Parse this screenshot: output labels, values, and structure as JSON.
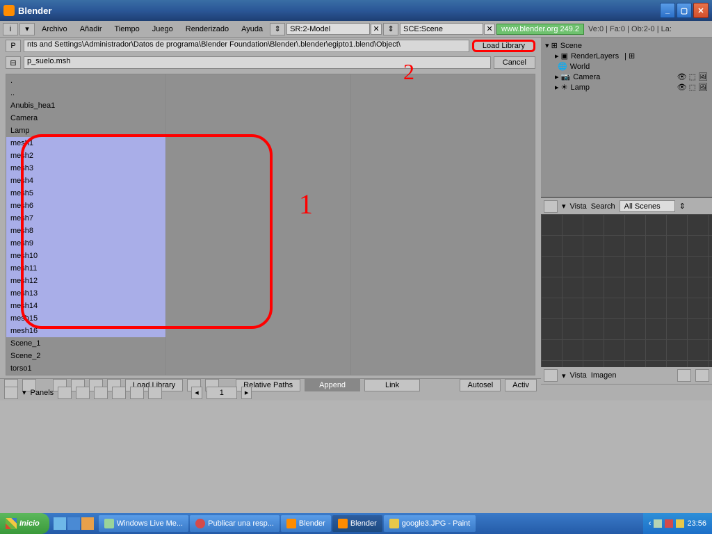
{
  "window": {
    "title": "Blender"
  },
  "menubar": {
    "items": [
      "Archivo",
      "Añadir",
      "Tiempo",
      "Juego",
      "Renderizado",
      "Ayuda"
    ],
    "screen_sel": "SR:2-Model",
    "scene_sel": "SCE:Scene",
    "url": "www.blender.org 249.2",
    "stats": "Ve:0 | Fa:0 | Ob:2-0 | La:"
  },
  "file": {
    "path": "nts and Settings\\Administrador\\Datos de programa\\Blender Foundation\\Blender\\.blender\\egipto1.blend\\Object\\",
    "filename": "p_suelo.msh",
    "load_btn": "Load Library",
    "cancel_btn": "Cancel",
    "items_top": [
      ".",
      "..",
      "Anubis_hea1",
      "Camera",
      "Lamp"
    ],
    "items_sel": [
      "mesh1",
      "mesh2",
      "mesh3",
      "mesh4",
      "mesh5",
      "mesh6",
      "mesh7",
      "mesh8",
      "mesh9",
      "mesh10",
      "mesh11",
      "mesh12",
      "mesh13",
      "mesh14",
      "mesh15",
      "mesh16"
    ],
    "items_bot": [
      "Scene_1",
      "Scene_2",
      "torso1"
    ]
  },
  "bottombar": {
    "loadlib": "Load Library",
    "relpaths": "Relative Paths",
    "append": "Append",
    "link": "Link",
    "autosel": "Autosel",
    "activ": "Activ"
  },
  "outliner": {
    "scene": "Scene",
    "renderlayers": "RenderLayers",
    "world": "World",
    "camera": "Camera",
    "lamp": "Lamp",
    "vista": "Vista",
    "search": "Search",
    "filter": "All Scenes"
  },
  "viewporttools": {
    "vista": "Vista",
    "imagen": "Imagen"
  },
  "panels": {
    "label": "Panels",
    "page": "1"
  },
  "taskbar": {
    "start": "Inicio",
    "items": [
      "Windows Live Me...",
      "Publicar una resp...",
      "Blender",
      "Blender",
      "google3.JPG - Paint"
    ],
    "time": "23:56"
  },
  "annotations": {
    "a1": "1",
    "a2": "2"
  }
}
